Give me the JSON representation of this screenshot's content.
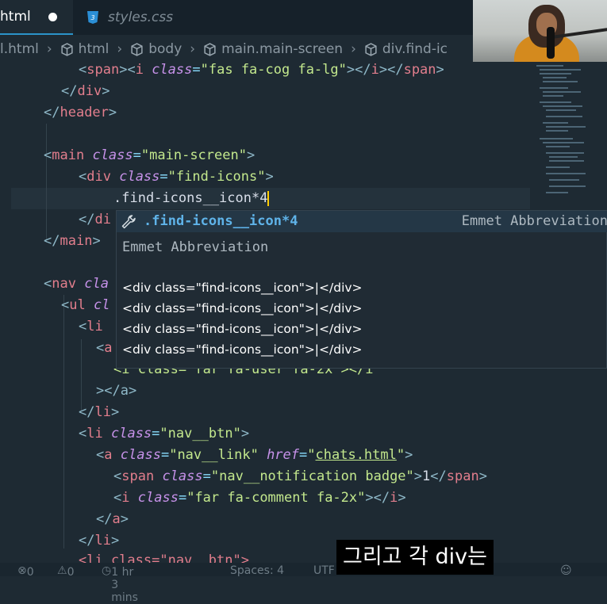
{
  "tabs": {
    "active_label": "html",
    "inactive_label": "styles.css"
  },
  "breadcrumb": {
    "file": "l.html",
    "items": [
      "html",
      "body",
      "main.main-screen",
      "div.find-ic"
    ]
  },
  "editor": {
    "lines": {
      "l1": {
        "tag": "span",
        "attr_tag": "i",
        "attr": "class",
        "val": "fas fa-cog fa-lg"
      },
      "div_close": "div",
      "header_close": "header",
      "main_open": {
        "tag": "main",
        "attr": "class",
        "val": "main-screen"
      },
      "div_open": {
        "tag": "div",
        "attr": "class",
        "val": "find-icons"
      },
      "typed": ".find-icons__icon*4",
      "div_close2": "di",
      "main_close": "main",
      "nav_open": {
        "tag": "nav",
        "attr": "cla"
      },
      "ul_open": {
        "tag": "ul",
        "attr": "cl"
      },
      "li_open": {
        "tag": "li"
      },
      "a_open": {
        "tag": "a"
      },
      "i_user": {
        "frag": "<i class=\"far fa-user fa-2x\"></i"
      },
      "a_close_partial": "></a>",
      "li_close": "li",
      "li_btn": {
        "tag": "li",
        "attr": "class",
        "val": "nav__btn"
      },
      "a_link": {
        "tag": "a",
        "attr": "class",
        "val": "nav__link",
        "attr2": "href",
        "val2": "chats.html"
      },
      "span_badge": {
        "tag": "span",
        "attr": "class",
        "val": "nav__notification badge",
        "text": "1"
      },
      "i_comment": {
        "tag": "i",
        "attr": "class",
        "val": "far fa-comment fa-2x"
      },
      "a_close": "a",
      "li_close2": "li",
      "li_partial": "<li class=\"nav__btn\">"
    }
  },
  "suggest": {
    "label_match": ".find-icons__icon*4",
    "type": "Emmet Abbreviation",
    "doc_title": "Emmet Abbreviation",
    "doc_lines": [
      "<div class=\"find-icons__icon\">|</div>",
      "<div class=\"find-icons__icon\">|</div>",
      "<div class=\"find-icons__icon\">|</div>",
      "<div class=\"find-icons__icon\">|</div>"
    ]
  },
  "status": {
    "errors": "0",
    "warnings": "0",
    "time": "1 hr 3 mins",
    "spaces": "Spaces: 4",
    "encoding": "UTF"
  },
  "subtitle": "그리고 각 div는"
}
